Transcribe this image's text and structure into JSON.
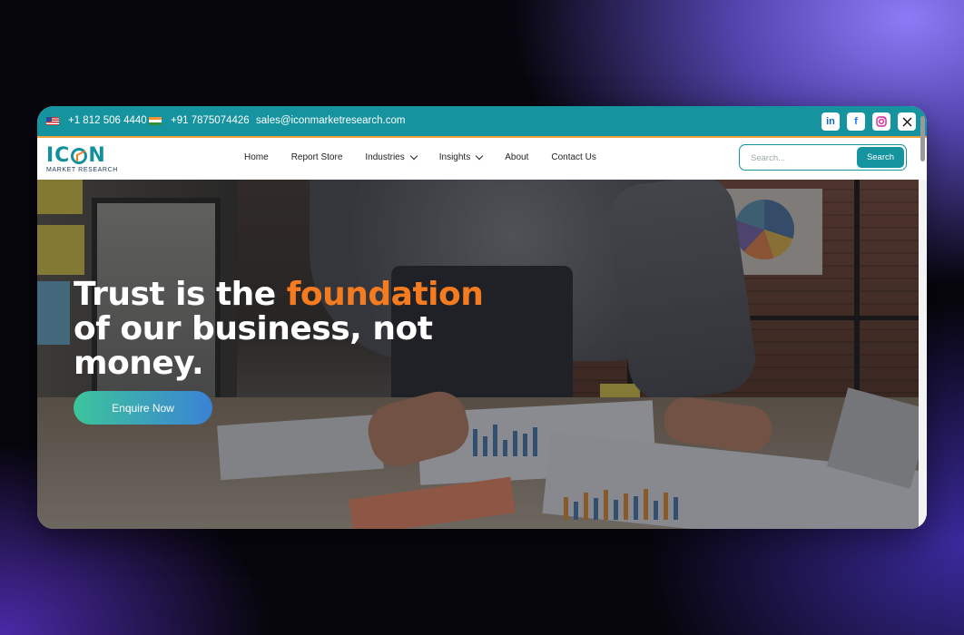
{
  "topbar": {
    "phone_us": "+1 812 506 4440",
    "phone_in": "+91 7875074426",
    "email": "sales@iconmarketresearch.com",
    "socials": [
      "linkedin-icon",
      "facebook-icon",
      "instagram-icon",
      "x-icon"
    ]
  },
  "logo": {
    "word_start": "IC",
    "word_end": "N",
    "sub": "MARKET RESEARCH"
  },
  "nav": {
    "items": [
      {
        "label": "Home",
        "dropdown": false
      },
      {
        "label": "Report Store",
        "dropdown": false
      },
      {
        "label": "Industries",
        "dropdown": true
      },
      {
        "label": "Insights",
        "dropdown": true
      },
      {
        "label": "About",
        "dropdown": false
      },
      {
        "label": "Contact Us",
        "dropdown": false
      }
    ]
  },
  "search": {
    "placeholder": "Search...",
    "button": "Search"
  },
  "hero": {
    "line1_start": "Trust is the ",
    "line1_accent": "foundation",
    "line2": "of our business, not",
    "line3": "money.",
    "cta": "Enquire Now"
  },
  "colors": {
    "brand": "#15939f",
    "accent": "#f47b20",
    "topbar_border": "#f2a23a"
  }
}
